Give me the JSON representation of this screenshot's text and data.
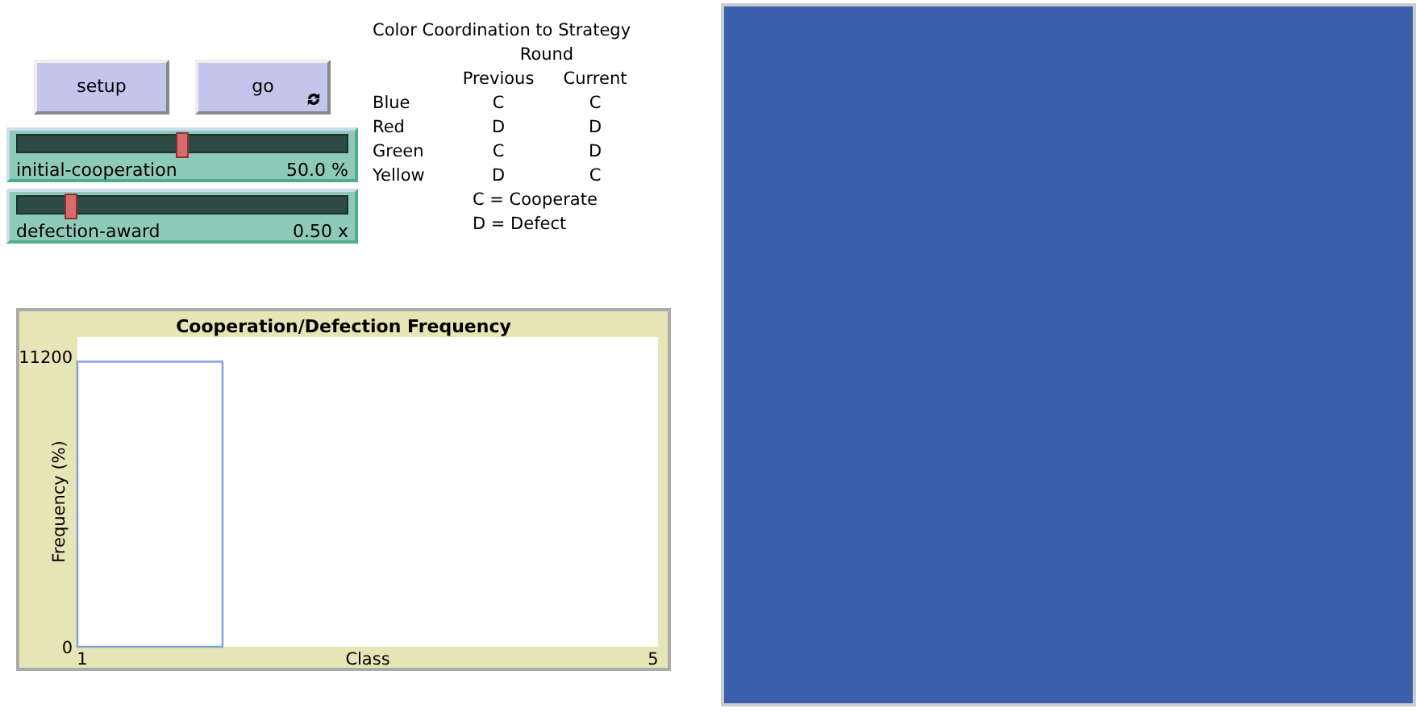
{
  "buttons": [
    {
      "label": "setup",
      "forever": false
    },
    {
      "label": "go",
      "forever": true
    }
  ],
  "sliders": [
    {
      "label": "initial-cooperation",
      "value": "50.0 %",
      "level": 0.5
    },
    {
      "label": "defection-award",
      "value": "0.50 x",
      "level": 0.16
    }
  ],
  "legend": {
    "title": "Color Coordination to Strategy",
    "subtitle": "Round",
    "columns": [
      "Previous",
      "Current"
    ],
    "rows": [
      {
        "color_name": "Blue",
        "previous": "C",
        "current": "C"
      },
      {
        "color_name": "Red",
        "previous": "D",
        "current": "D"
      },
      {
        "color_name": "Green",
        "previous": "C",
        "current": "D"
      },
      {
        "color_name": "Yellow",
        "previous": "D",
        "current": "C"
      }
    ],
    "notes": [
      "C = Cooperate",
      "D = Defect"
    ]
  },
  "plot": {
    "chart_data": {
      "type": "bar",
      "title": "Cooperation/Defection Frequency",
      "xlabel": "Class",
      "ylabel": "Frequency (%)",
      "x": [
        1.5
      ],
      "values": [
        11000
      ],
      "xlim": [
        1,
        5
      ],
      "ylim": [
        0,
        11200
      ],
      "xticks": [
        1,
        5
      ],
      "yticks": [
        0,
        11200
      ]
    }
  },
  "world": {
    "color": "#3a5fab"
  }
}
